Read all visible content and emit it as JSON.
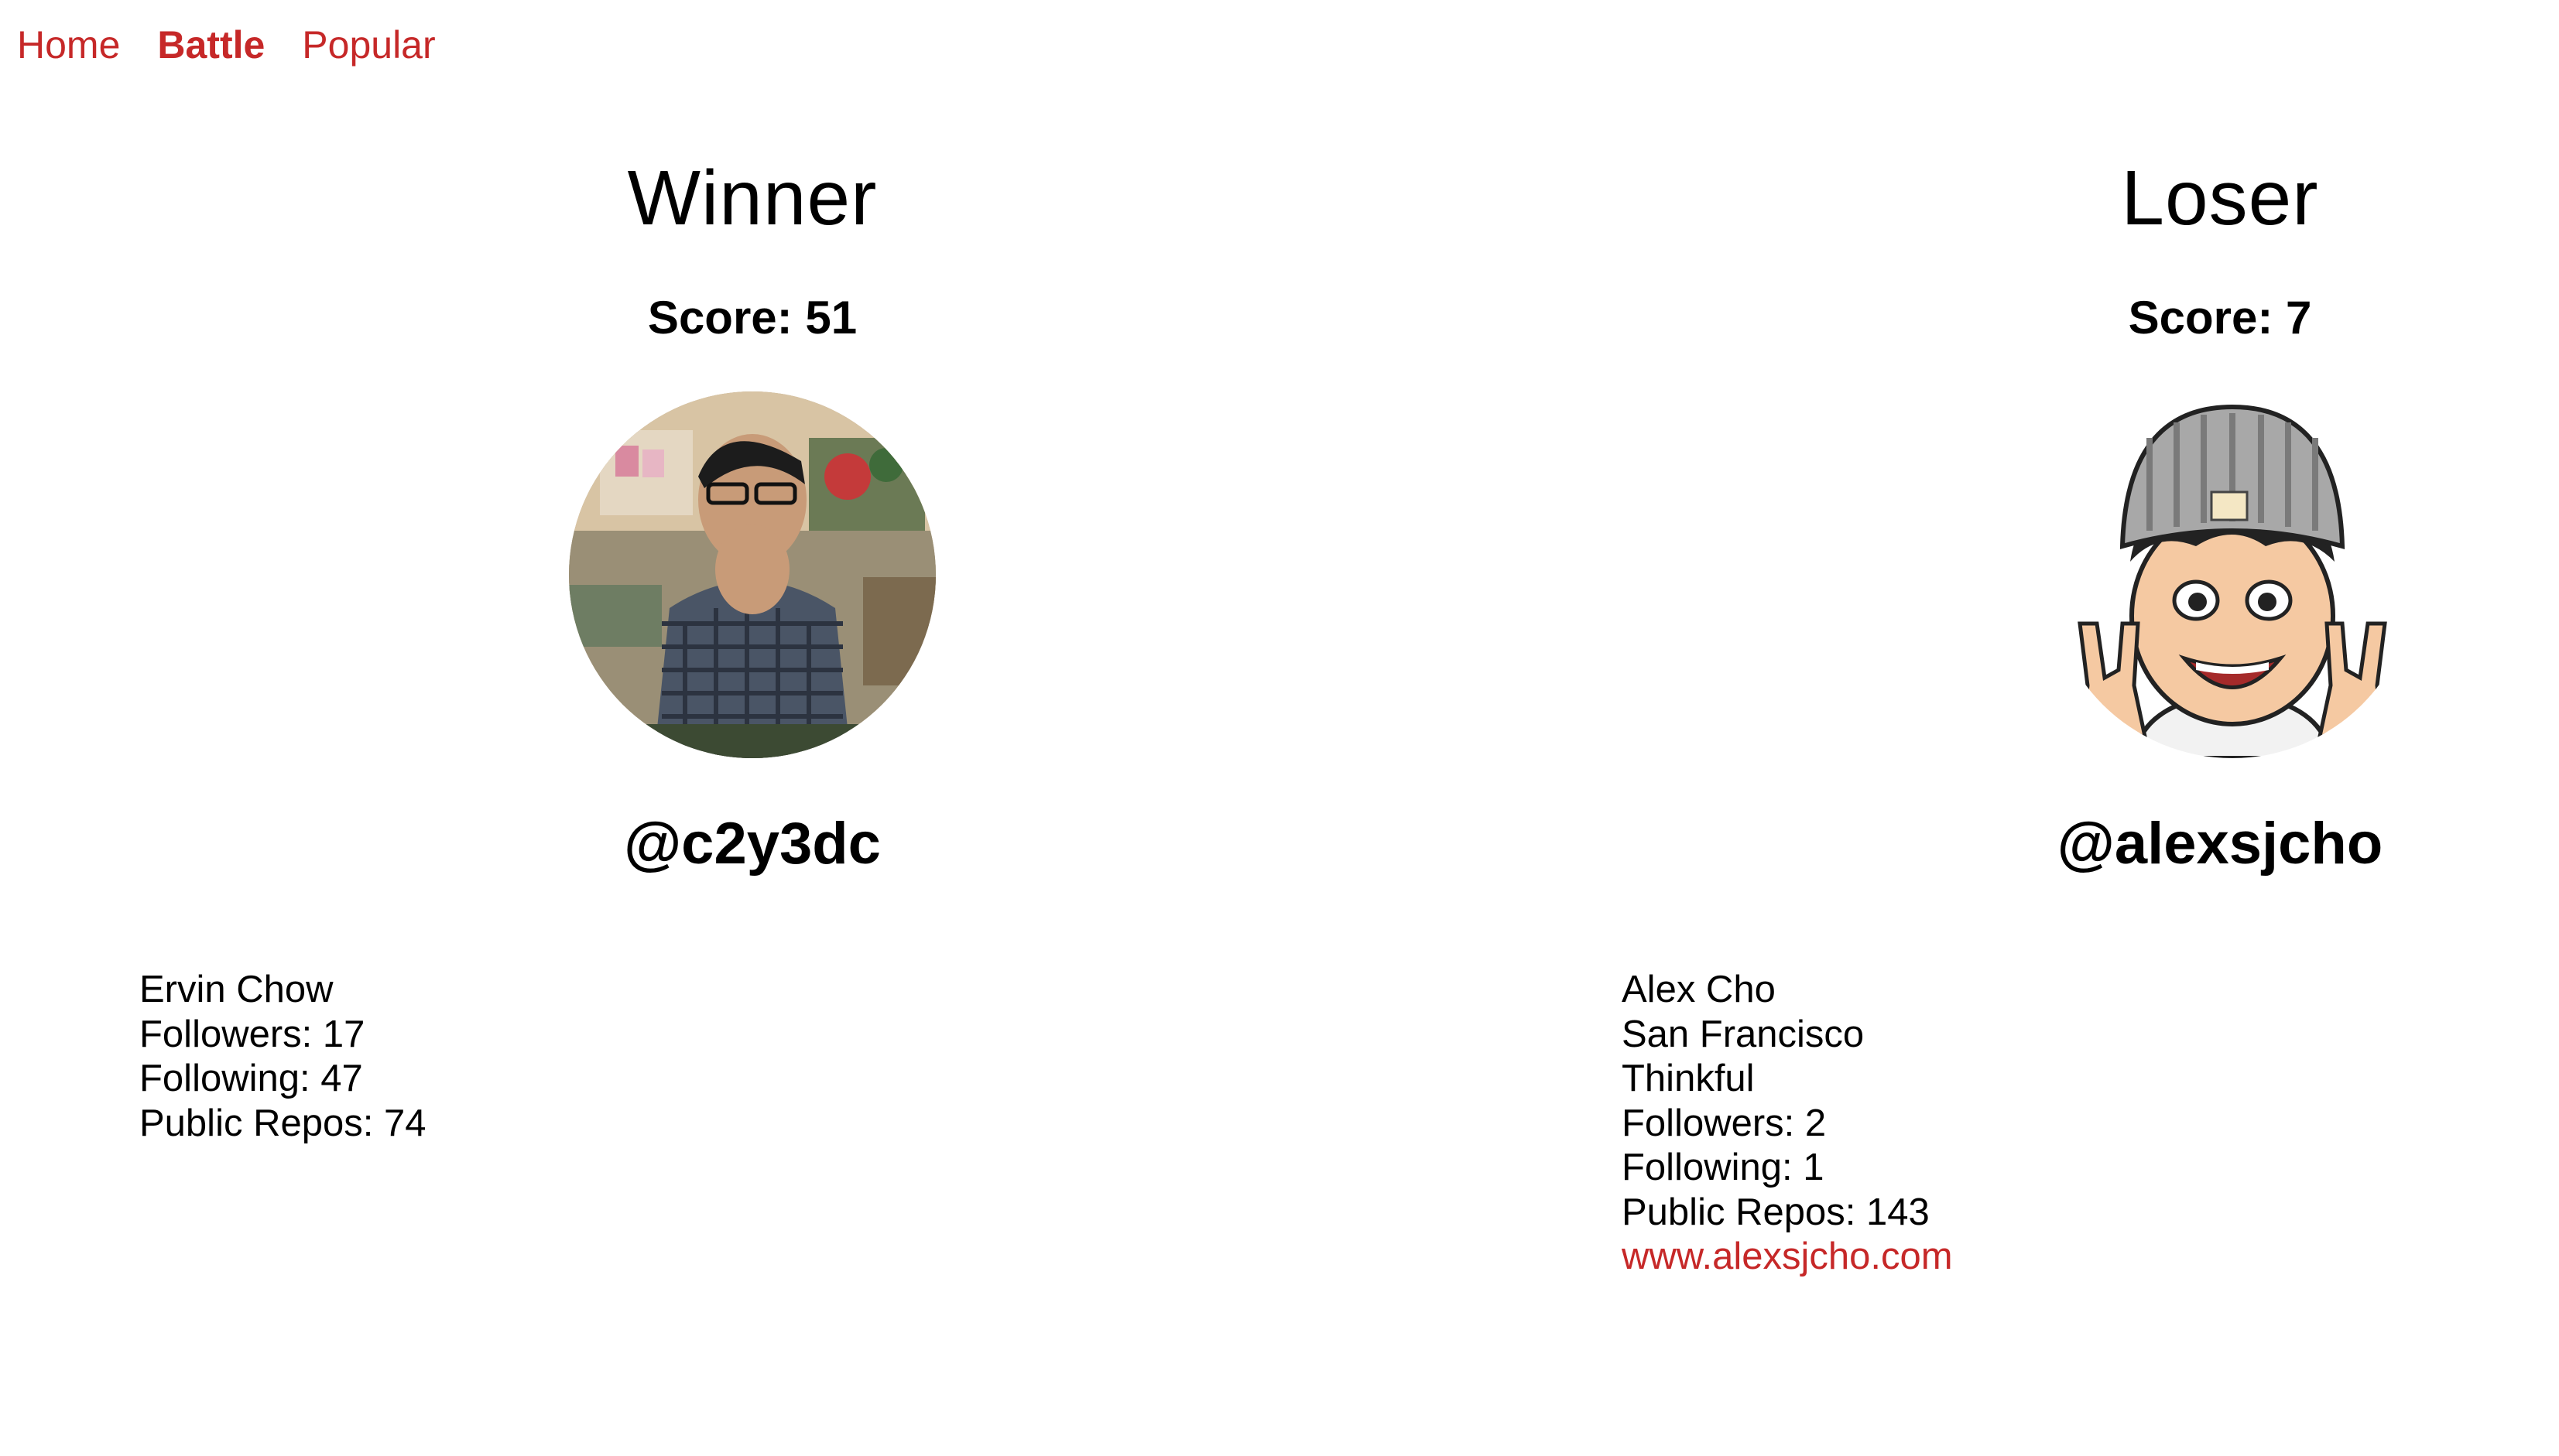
{
  "nav": {
    "items": [
      {
        "label": "Home",
        "active": false
      },
      {
        "label": "Battle",
        "active": true
      },
      {
        "label": "Popular",
        "active": false
      }
    ]
  },
  "players": {
    "winner": {
      "heading": "Winner",
      "score": "Score: 51",
      "login": "@c2y3dc",
      "name": "Ervin Chow",
      "followers": "Followers: 17",
      "following": "Following: 47",
      "public_repos": "Public Repos: 74",
      "avatar_icon": "person-photo-avatar"
    },
    "loser": {
      "heading": "Loser",
      "score": "Score: 7",
      "login": "@alexsjcho",
      "name": "Alex Cho",
      "location": "San Francisco",
      "company": "Thinkful",
      "followers": "Followers: 2",
      "following": "Following: 1",
      "public_repos": "Public Repos: 143",
      "blog": "www.alexsjcho.com",
      "avatar_icon": "cartoon-emoji-avatar"
    }
  },
  "colors": {
    "accent": "#c62828",
    "text": "#000000",
    "background": "#ffffff"
  }
}
